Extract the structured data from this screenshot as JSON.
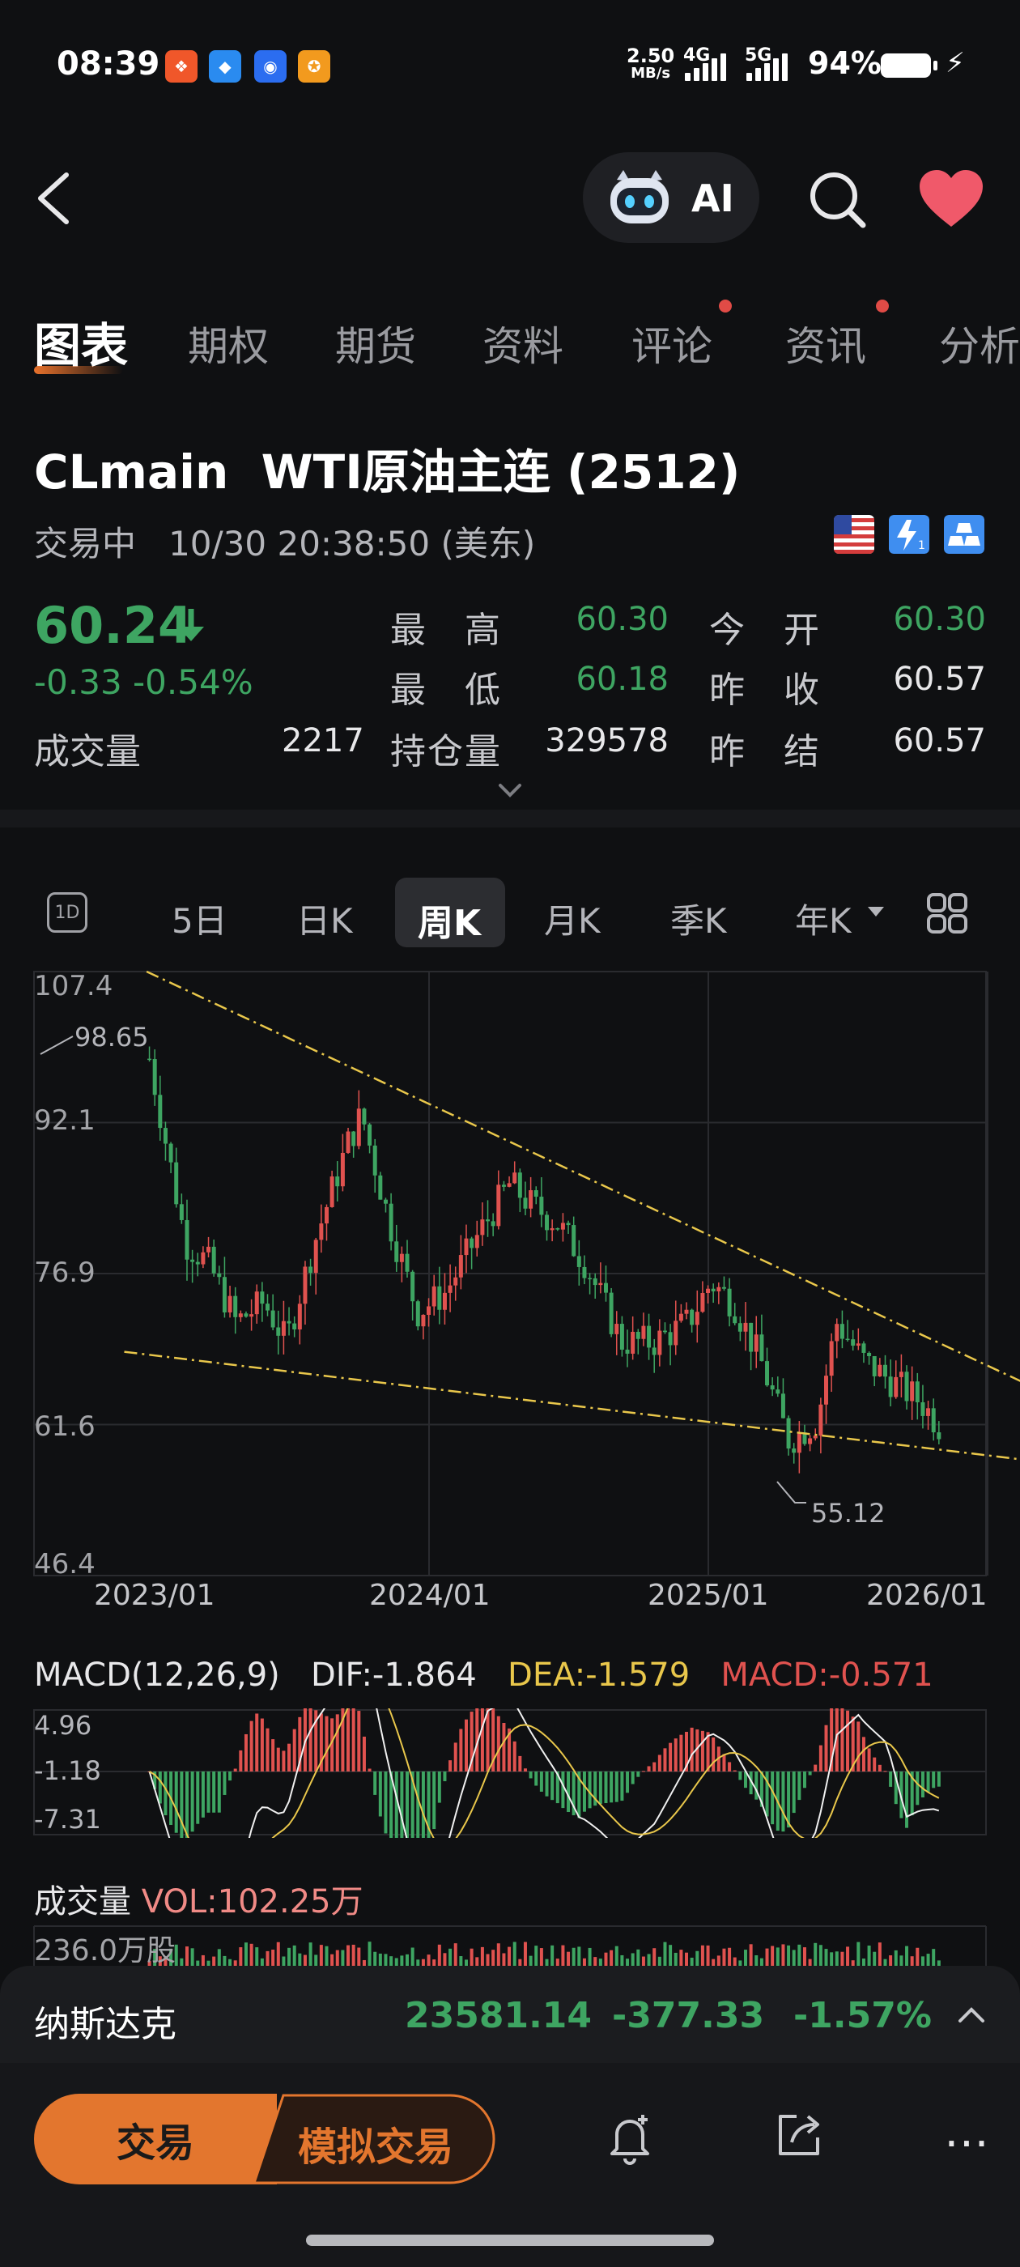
{
  "status_bar": {
    "time": "08:39",
    "net_speed_value": "2.50",
    "net_speed_unit": "MB/s",
    "net1": "4G",
    "net2": "5G",
    "battery": "94%",
    "notification_icons": [
      "pinduoduo-icon",
      "message-icon",
      "radio-icon",
      "rewards-icon"
    ]
  },
  "header": {
    "ai_label": "AI"
  },
  "tabs": [
    {
      "label": "图表",
      "active": true
    },
    {
      "label": "期权",
      "dot": false
    },
    {
      "label": "期货",
      "dot": false
    },
    {
      "label": "资料",
      "dot": false
    },
    {
      "label": "评论",
      "dot": true
    },
    {
      "label": "资讯",
      "dot": true
    },
    {
      "label": "分析",
      "dot": false
    }
  ],
  "instrument": {
    "symbol": "CLmain",
    "name": "WTI原油主连 (2512)",
    "trade_status": "交易中",
    "timestamp": "10/30 20:38:50 (美东)",
    "price": "60.24",
    "change": "-0.33",
    "change_pct": "-0.54%",
    "volume_label": "成交量",
    "volume": "2217",
    "quotes": [
      {
        "label": "最　高",
        "value": "60.30",
        "color": "green"
      },
      {
        "label": "最　低",
        "value": "60.18",
        "color": "green"
      },
      {
        "label": "持仓量",
        "value": "329578",
        "color": "white"
      },
      {
        "label": "今　开",
        "value": "60.30",
        "color": "green"
      },
      {
        "label": "昨　收",
        "value": "60.57",
        "color": "white"
      },
      {
        "label": "昨　结",
        "value": "60.57",
        "color": "white"
      }
    ]
  },
  "periods": {
    "icon_1d": "1D",
    "items": [
      "5日",
      "日K",
      "周K",
      "月K",
      "季K",
      "年K"
    ],
    "active": "周K"
  },
  "chart_data": {
    "type": "candlestick",
    "ylim": [
      46.4,
      107.4
    ],
    "y_ticks": [
      "107.4",
      "92.1",
      "76.9",
      "61.6",
      "46.4"
    ],
    "x_ticks": [
      "2023/01",
      "2024/01",
      "2025/01",
      "2026/01"
    ],
    "high_label": "98.65",
    "low_label": "55.12",
    "upper_trendline": [
      [
        2022.98,
        107.4
      ],
      [
        2026.15,
        65.5
      ]
    ],
    "lower_trendline": [
      [
        2022.9,
        69.0
      ],
      [
        2026.15,
        58.0
      ]
    ],
    "colors": {
      "up": "#e0524f",
      "down": "#3ea562",
      "trend": "#e9c74b"
    }
  },
  "macd": {
    "label": "MACD(12,26,9)",
    "dif": "DIF:-1.864",
    "dea": "DEA:-1.579",
    "macd": "MACD:-0.571",
    "y_ticks": [
      "4.96",
      "-1.18",
      "-7.31"
    ]
  },
  "volume": {
    "label": "成交量",
    "vol": "VOL:102.25万",
    "y_max": "236.0万股"
  },
  "nasdaq": {
    "name": "纳斯达克",
    "value": "23581.14",
    "change": "-377.33",
    "change_pct": "-1.57%"
  },
  "bottom": {
    "trade": "交易",
    "sim_trade": "模拟交易"
  }
}
